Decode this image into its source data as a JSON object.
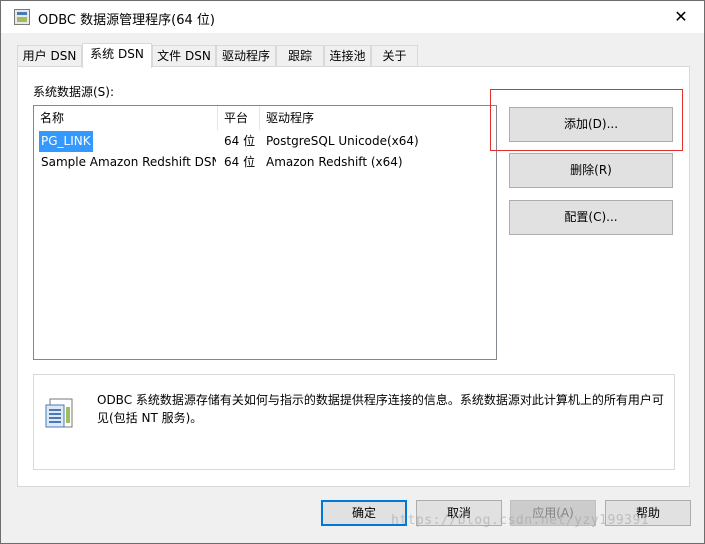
{
  "window": {
    "title": "ODBC 数据源管理程序(64 位)",
    "close_glyph": "✕"
  },
  "tabs": [
    {
      "label": "用户 DSN"
    },
    {
      "label": "系统 DSN"
    },
    {
      "label": "文件 DSN"
    },
    {
      "label": "驱动程序"
    },
    {
      "label": "跟踪"
    },
    {
      "label": "连接池"
    },
    {
      "label": "关于"
    }
  ],
  "system_dsn": {
    "group_label": "系统数据源(S):",
    "columns": [
      "名称",
      "平台",
      "驱动程序"
    ],
    "rows": [
      {
        "name": "PG_LINK",
        "platform": "64 位",
        "driver": "PostgreSQL Unicode(x64)",
        "selected": true
      },
      {
        "name": "Sample Amazon Redshift DSN",
        "platform": "64 位",
        "driver": "Amazon Redshift (x64)",
        "selected": false
      }
    ],
    "buttons": {
      "add": "添加(D)...",
      "remove": "删除(R)",
      "configure": "配置(C)..."
    },
    "info_text": "ODBC 系统数据源存储有关如何与指示的数据提供程序连接的信息。系统数据源对此计算机上的所有用户可见(包括 NT 服务)。"
  },
  "footer": {
    "ok": "确定",
    "cancel": "取消",
    "apply": "应用(A)",
    "help": "帮助"
  },
  "watermark": "https://blog.csdn.net/yzy199391",
  "colors": {
    "selection": "#3399ff",
    "default_button_border": "#0078d7",
    "annotation_box": "#e03030"
  }
}
